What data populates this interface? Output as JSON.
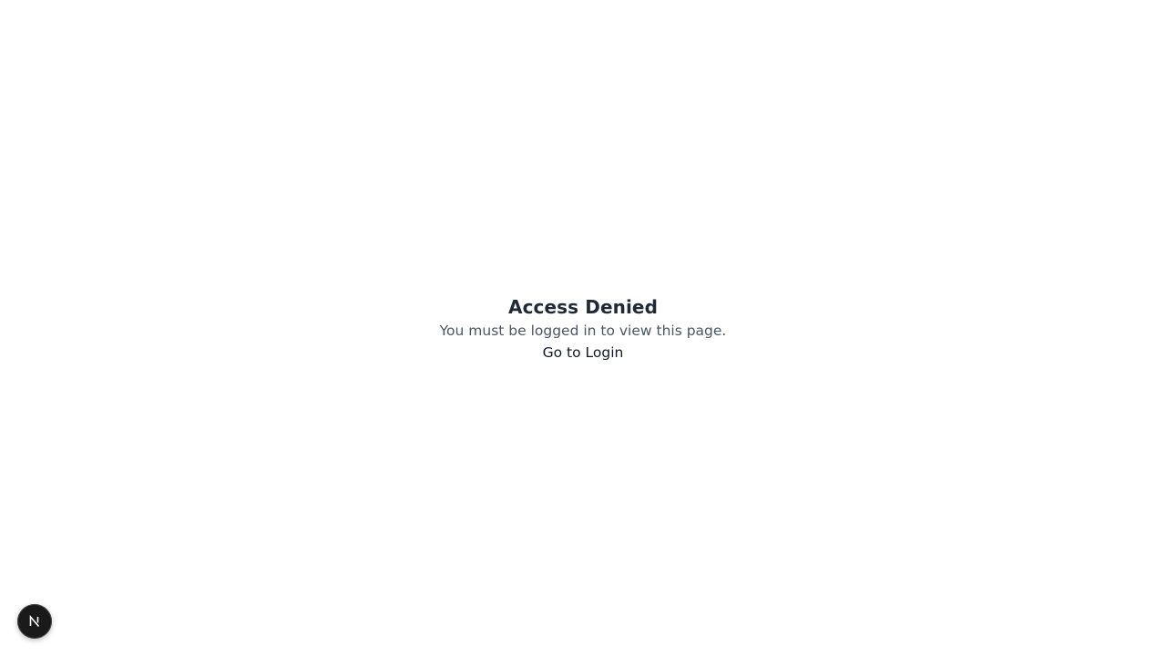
{
  "main": {
    "title": "Access Denied",
    "message": "You must be logged in to view this page.",
    "login_link": "Go to Login"
  },
  "dev_indicator": {
    "icon": "nextjs-logo-icon",
    "letter": "N"
  }
}
